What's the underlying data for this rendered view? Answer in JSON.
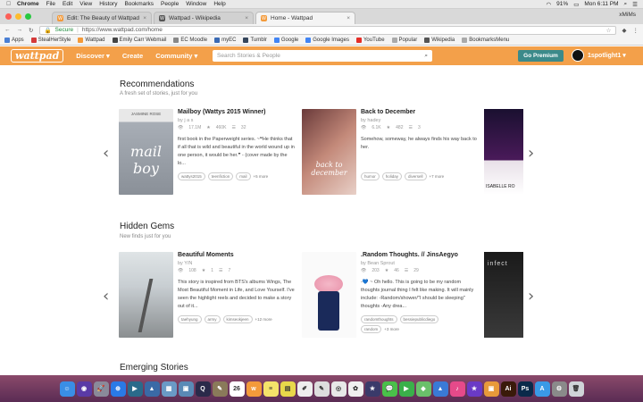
{
  "mac_menu": {
    "app": "Chrome",
    "items": [
      "File",
      "Edit",
      "View",
      "History",
      "Bookmarks",
      "People",
      "Window",
      "Help"
    ],
    "battery": "91%",
    "clock": "Mon 6:11 PM"
  },
  "tabs": [
    {
      "title": "Edit: The Beauty of Wattpad",
      "color": "#f39a3a",
      "icon": "W"
    },
    {
      "title": "Wattpad - Wikipedia",
      "color": "#555555",
      "icon": "W"
    },
    {
      "title": "Home - Wattpad",
      "color": "#f39a3a",
      "icon": "W"
    }
  ],
  "tab_user": "xMiMs",
  "address": {
    "secure": "Secure",
    "url": "https://www.wattpad.com/home"
  },
  "bookmarks": [
    {
      "label": "Apps",
      "color": "#4a7fd4"
    },
    {
      "label": "StealHerStyle",
      "color": "#d43a3a"
    },
    {
      "label": "Wattpad",
      "color": "#f39a3a"
    },
    {
      "label": "Emily Carr Webmail",
      "color": "#444444"
    },
    {
      "label": "EC Moodle",
      "color": "#888888"
    },
    {
      "label": "myEC",
      "color": "#3a6ab4"
    },
    {
      "label": "Tumblr",
      "color": "#35465c"
    },
    {
      "label": "Google",
      "color": "#4285f4"
    },
    {
      "label": "Google Images",
      "color": "#4285f4"
    },
    {
      "label": "YouTube",
      "color": "#e52d27"
    },
    {
      "label": "Popular",
      "color": "#aaaaaa"
    },
    {
      "label": "Wikipedia",
      "color": "#555555"
    },
    {
      "label": "BookmarksMenu",
      "color": "#aaaaaa"
    }
  ],
  "nav": {
    "logo": "wattpad",
    "discover": "Discover ▾",
    "create": "Create",
    "community": "Community ▾",
    "search_placeholder": "Search Stories & People",
    "premium": "Go Premium",
    "username": "1spotlight1 ▾"
  },
  "sections": [
    {
      "title": "Recommendations",
      "subtitle": "A fresh set of stories, just for you",
      "stories": [
        {
          "title": "Mailboy (Wattys 2015 Winner)",
          "author": "by j a s",
          "reads": "17.1M",
          "votes": "460K",
          "parts": "32",
          "desc": "first book in the Paperweight series. ~❝He thinks that if all that is wild and beautiful in the world wound up in one person, it would be her.❞ - (cover made by the lo...",
          "tags": [
            "wattys2015",
            "teenfiction",
            "mail"
          ],
          "more": "+5 more",
          "cover_color": "#9aa0a8"
        },
        {
          "title": "Back to December",
          "author": "by hadey",
          "reads": "6.1K",
          "votes": "482",
          "parts": "3",
          "desc": "Somehow, someway, he always finds his way back to her.",
          "tags": [
            "humor",
            "holiday",
            "diversell"
          ],
          "more": "+7 more",
          "cover_color": "#b06a5a"
        }
      ]
    },
    {
      "title": "Hidden Gems",
      "subtitle": "New finds just for you",
      "stories": [
        {
          "title": "Beautiful Moments",
          "author": "by Y/N",
          "reads": "108",
          "votes": "1",
          "parts": "7",
          "desc": "This story is inspired from BTS's albums Wings, The Most Beautiful Moment in Life, and Love Yourself. I've seen the highlight reels and decided to make a story out of it...",
          "tags": [
            "taehyung",
            "army",
            "kimseokjeen"
          ],
          "more": "+12 more",
          "cover_color": "#b7c0c4"
        },
        {
          "title": ".Random Thoughts. // JinsAegyo",
          "author": "by Bean Sprout",
          "reads": "203",
          "votes": "46",
          "parts": "29",
          "desc": "-💙 ~ Oh hello. This is going to be my random thoughts journal thing I felt like making. It will mainly include: -Random/shower/\"I should be sleeping\" thoughts -Any drea...",
          "tags": [
            "randomthoughts",
            "bessiepublicdiego",
            "random"
          ],
          "more": "+3 more",
          "cover_color": "#f4f4f4"
        }
      ]
    },
    {
      "title": "Emerging Stories"
    }
  ],
  "dock_apps": [
    {
      "name": "finder",
      "color": "#3a8ee6",
      "glyph": "☺"
    },
    {
      "name": "siri",
      "color": "#5a3aa6",
      "glyph": "◉"
    },
    {
      "name": "launchpad",
      "color": "#8a8a9a",
      "glyph": "🚀"
    },
    {
      "name": "safari",
      "color": "#2a7ae6",
      "glyph": "⊕"
    },
    {
      "name": "app-1",
      "color": "#2a6a8a",
      "glyph": "▶"
    },
    {
      "name": "app-2",
      "color": "#3a6aa6",
      "glyph": "▲"
    },
    {
      "name": "photos-slides",
      "color": "#6a9ac6",
      "glyph": "▦"
    },
    {
      "name": "preview",
      "color": "#5a8ab6",
      "glyph": "▣"
    },
    {
      "name": "quicktime",
      "color": "#2a2a4a",
      "glyph": "Q"
    },
    {
      "name": "app-3",
      "color": "#8a7a5a",
      "glyph": "✎"
    },
    {
      "name": "calendar",
      "color": "#ffffff",
      "glyph": "26"
    },
    {
      "name": "wattpad",
      "color": "#f39a3a",
      "glyph": "w"
    },
    {
      "name": "notes",
      "color": "#f4e36a",
      "glyph": "≡"
    },
    {
      "name": "stickies",
      "color": "#e8d84a",
      "glyph": "▤"
    },
    {
      "name": "textedit",
      "color": "#eeeeee",
      "glyph": "✐"
    },
    {
      "name": "textedit-2",
      "color": "#dddddd",
      "glyph": "✎"
    },
    {
      "name": "chrome",
      "color": "#e8e8e8",
      "glyph": "◎"
    },
    {
      "name": "photos",
      "color": "#f0f0f0",
      "glyph": "✿"
    },
    {
      "name": "imovie",
      "color": "#3a3a6a",
      "glyph": "★"
    },
    {
      "name": "messages",
      "color": "#4ac04a",
      "glyph": "💬"
    },
    {
      "name": "facetime",
      "color": "#3ab04a",
      "glyph": "▶"
    },
    {
      "name": "maps",
      "color": "#6ac06a",
      "glyph": "◆"
    },
    {
      "name": "keynote",
      "color": "#3a7ad6",
      "glyph": "▲"
    },
    {
      "name": "itunes",
      "color": "#e64a8a",
      "glyph": "♪"
    },
    {
      "name": "app-4",
      "color": "#6a3ac6",
      "glyph": "★"
    },
    {
      "name": "ibooks",
      "color": "#e89a3a",
      "glyph": "▣"
    },
    {
      "name": "illustrator",
      "color": "#3a1a0a",
      "glyph": "Ai"
    },
    {
      "name": "photoshop",
      "color": "#0a2a4a",
      "glyph": "Ps"
    },
    {
      "name": "app-store",
      "color": "#3a9ae6",
      "glyph": "A"
    },
    {
      "name": "system-preferences",
      "color": "#8a8a8a",
      "glyph": "⚙"
    },
    {
      "name": "trash",
      "color": "#cfd4d8",
      "glyph": "🗑"
    }
  ]
}
